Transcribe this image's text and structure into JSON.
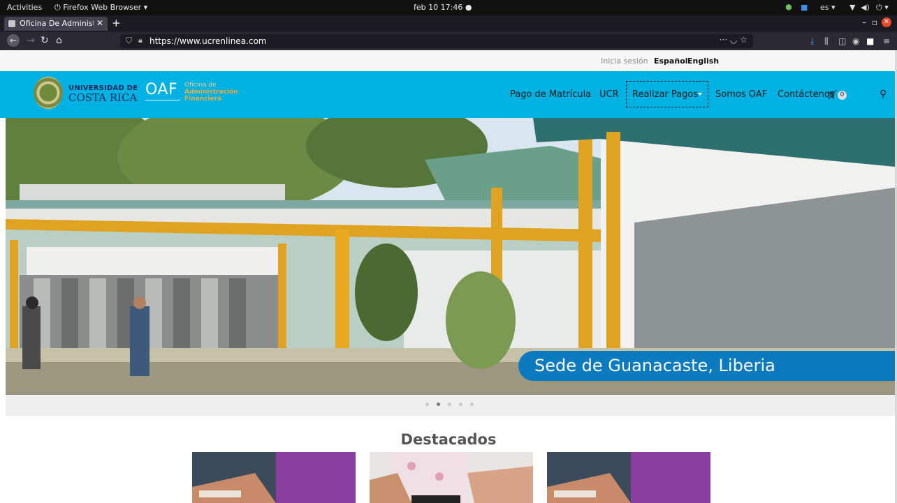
{
  "topbar": {
    "activities": "Activities",
    "app_name": "Firefox Web Browser",
    "datetime": "feb 10  17:46",
    "keyboard": "es"
  },
  "browser": {
    "tab_title": "Oficina De Administració",
    "url": "https://www.ucrenlinea.com",
    "url_more": "···"
  },
  "site": {
    "login": "Inicia sesión",
    "lang_es": "Español",
    "lang_en": "English",
    "ucr_top": "UNIVERSIDAD DE",
    "ucr_bottom": "COSTA RICA",
    "oaf": "OAF",
    "oaf_sub": [
      "Oficina de",
      "Administración",
      "Financiera"
    ],
    "menu": [
      "Pago de Matrícula",
      "UCR",
      "Realizar Pagos",
      "Somos OAF",
      "Contáctenos"
    ],
    "cart_count": "0"
  },
  "hero": {
    "caption": "Sede de Guanacaste, Liberia",
    "slides": 5,
    "active_slide": 2
  },
  "featured": {
    "title": "Destacados"
  },
  "colors": {
    "nav_blue": "#00b2e3",
    "caption_blue": "#0b7abf",
    "oaf_orange": "#f2a93b"
  }
}
